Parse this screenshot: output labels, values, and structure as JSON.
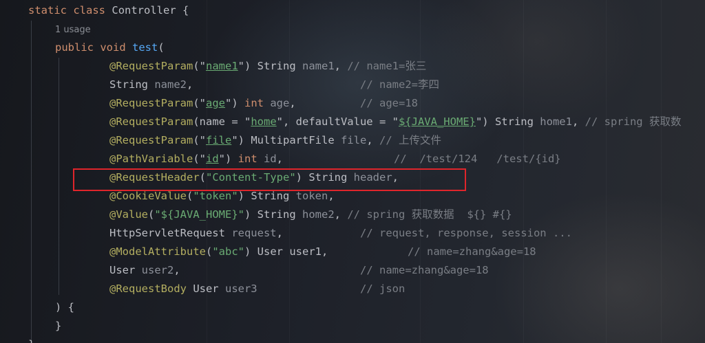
{
  "code": {
    "class_decl": {
      "kw1": "static",
      "kw2": "class",
      "name": "Controller",
      "brace": "{"
    },
    "usage_hint": "1 usage",
    "method_decl": {
      "kw1": "public",
      "kw2": "void",
      "name": "test",
      "paren": "("
    },
    "lines": [
      {
        "ann": "@RequestParam",
        "p1": "(\"",
        "str": "name1",
        "p2": "\")",
        "type": " String ",
        "param": "name1",
        "tail": ", ",
        "comment": "// name1=张三"
      },
      {
        "type": "String ",
        "param": "name2",
        "tail": ",",
        "comment": "// name2=李四"
      },
      {
        "ann": "@RequestParam",
        "p1": "(\"",
        "str": "age",
        "p2": "\")",
        "kw": " int",
        "param": " age",
        "tail": ",",
        "comment": "// age=18"
      },
      {
        "ann": "@RequestParam",
        "p1": "(name = \"",
        "str": "home",
        "p2": "\", defaultValue = \"",
        "str2": "${JAVA_HOME}",
        "p3": "\") String ",
        "param": "home1",
        "tail": ", ",
        "comment": "// spring 获取数"
      },
      {
        "ann": "@RequestParam",
        "p1": "(\"",
        "str": "file",
        "p2": "\")",
        "type": " MultipartFile ",
        "param": "file",
        "tail": ", ",
        "comment": "// 上传文件"
      },
      {
        "ann": "@PathVariable",
        "p1": "(\"",
        "str": "id",
        "p2": "\")",
        "kw": " int",
        "param": " id",
        "tail": ",",
        "comment": "//  /test/124   /test/{id}"
      },
      {
        "ann": "@RequestHeader",
        "p1": "(",
        "str": "\"Content-Type\"",
        "p2": ")",
        "type": " String ",
        "param": "header",
        "tail": ","
      },
      {
        "ann": "@CookieValue",
        "p1": "(",
        "str": "\"token\"",
        "p2": ")",
        "type": " String ",
        "param": "token",
        "tail": ","
      },
      {
        "ann": "@Value",
        "p1": "(",
        "str": "\"${JAVA_HOME}\"",
        "p2": ")",
        "type": " String ",
        "param": "home2",
        "tail": ", ",
        "comment": "// spring 获取数据  ${} #{}"
      },
      {
        "type": "HttpServletRequest ",
        "param": "request",
        "tail": ",",
        "comment": "// request, response, session ..."
      },
      {
        "ann": "@ModelAttribute",
        "p1": "(",
        "str": "\"abc\"",
        "p2": ")",
        "type": " User user1,",
        "comment": "// name=zhang&age=18"
      },
      {
        "type": "User ",
        "param": "user2",
        "tail": ",",
        "comment": "// name=zhang&age=18"
      },
      {
        "ann": "@RequestBody",
        "type": " User ",
        "param": "user3",
        "comment": "// json"
      }
    ],
    "close_paren": ") {",
    "close_method": "}",
    "close_class": "}"
  },
  "colors": {
    "keyword": "#cf8e6d",
    "function": "#56a8f5",
    "annotation": "#b3ae60",
    "string": "#6aab73",
    "parameter": "#8d919a",
    "comment": "#7a7e85",
    "text": "#bcbec4",
    "highlight_box": "#e0252b"
  }
}
